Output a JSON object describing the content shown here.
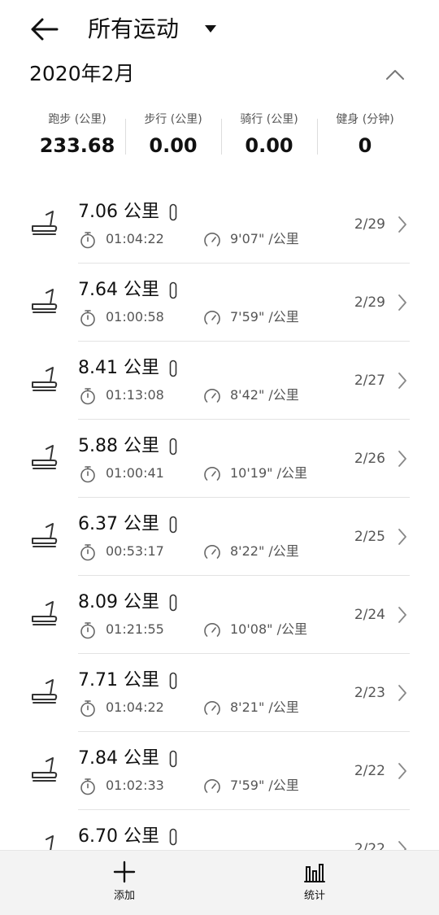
{
  "header": {
    "title": "所有运动"
  },
  "month": "2020年2月",
  "summary": [
    {
      "label": "跑步 (公里)",
      "value": "233.68"
    },
    {
      "label": "步行 (公里)",
      "value": "0.00"
    },
    {
      "label": "骑行 (公里)",
      "value": "0.00"
    },
    {
      "label": "健身 (分钟)",
      "value": "0"
    }
  ],
  "records": [
    {
      "distance": "7.06 公里",
      "duration": "01:04:22",
      "pace": "9'07\" /公里",
      "date": "2/29"
    },
    {
      "distance": "7.64 公里",
      "duration": "01:00:58",
      "pace": "7'59\" /公里",
      "date": "2/29"
    },
    {
      "distance": "8.41 公里",
      "duration": "01:13:08",
      "pace": "8'42\" /公里",
      "date": "2/27"
    },
    {
      "distance": "5.88 公里",
      "duration": "01:00:41",
      "pace": "10'19\" /公里",
      "date": "2/26"
    },
    {
      "distance": "6.37 公里",
      "duration": "00:53:17",
      "pace": "8'22\" /公里",
      "date": "2/25"
    },
    {
      "distance": "8.09 公里",
      "duration": "01:21:55",
      "pace": "10'08\" /公里",
      "date": "2/24"
    },
    {
      "distance": "7.71 公里",
      "duration": "01:04:22",
      "pace": "8'21\" /公里",
      "date": "2/23"
    },
    {
      "distance": "7.84 公里",
      "duration": "01:02:33",
      "pace": "7'59\" /公里",
      "date": "2/22"
    },
    {
      "distance": "6.70 公里",
      "duration": "",
      "pace": "",
      "date": "2/22"
    }
  ],
  "bottom_bar": {
    "add_label": "添加",
    "stats_label": "统计"
  },
  "icons": {
    "back": "back-arrow-icon",
    "dropdown": "triangle-down-icon",
    "collapse": "chevron-up-icon",
    "activity": "treadmill-icon",
    "device": "band-icon",
    "duration": "stopwatch-icon",
    "pace": "speedometer-icon",
    "open": "chevron-right-icon",
    "add": "plus-icon",
    "stats": "bar-chart-icon"
  }
}
